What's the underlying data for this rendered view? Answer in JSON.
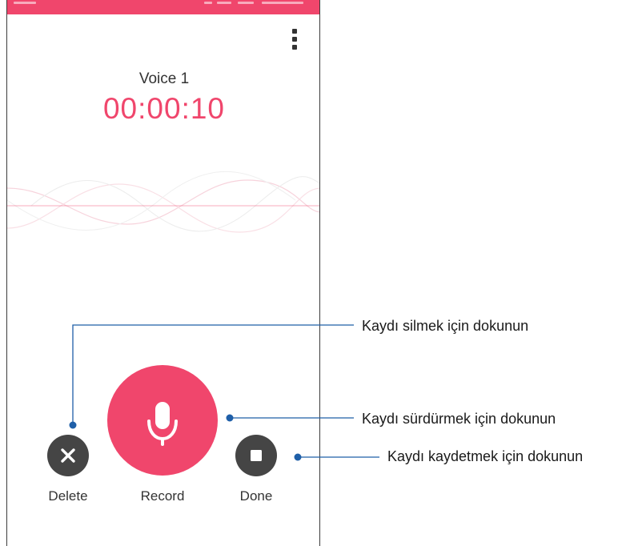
{
  "recording": {
    "name": "Voice 1",
    "elapsed": "00:00:10"
  },
  "controls": {
    "delete_label": "Delete",
    "record_label": "Record",
    "done_label": "Done"
  },
  "callouts": {
    "delete": "Kaydı silmek için dokunun",
    "record": "Kaydı sürdürmek için dokunun",
    "done": "Kaydı kaydetmek için dokunun"
  },
  "icons": {
    "menu": "overflow-menu-icon",
    "delete": "close-icon",
    "record": "microphone-icon",
    "done": "stop-icon"
  },
  "colors": {
    "accent": "#f0466c",
    "button_dark": "#454545",
    "callout_line": "#1f5fa8"
  }
}
